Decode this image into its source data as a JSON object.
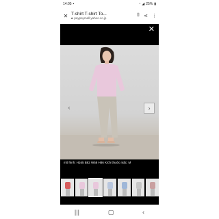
{
  "status": {
    "time": "14:05",
    "battery": "25%"
  },
  "browser": {
    "title": "T-shirt T-shirt To...",
    "url": "paypaymall.yahoo.co.jp"
  },
  "viewer": {
    "caption": "mô hình: H165 B82 W58 H86 Kích thước mặc: M",
    "thumbnails": [
      {
        "name": "thumb-1",
        "shirt": "#d55b5b"
      },
      {
        "name": "thumb-2",
        "shirt": "#e9c8dc"
      },
      {
        "name": "thumb-3",
        "shirt": "#e9c8dc"
      },
      {
        "name": "thumb-4",
        "shirt": "#b9c7de"
      },
      {
        "name": "thumb-5",
        "shirt": "#9fb7d8"
      },
      {
        "name": "thumb-6",
        "shirt": "#c6c6c6"
      },
      {
        "name": "thumb-7",
        "shirt": "#c9a0a0"
      }
    ]
  },
  "icons": {
    "close": "close-icon",
    "lock": "lock-icon",
    "bookmark": "bookmark-icon",
    "share": "share-icon",
    "more": "more-icon"
  },
  "colors": {
    "accent": "#000000",
    "shirt": "#e9c8dc",
    "pants": "#c9c3b8"
  }
}
